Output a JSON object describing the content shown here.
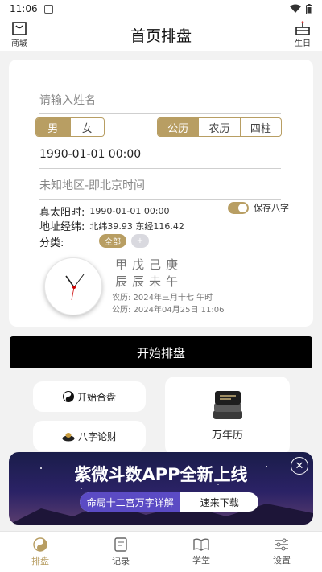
{
  "status_bar": {
    "time": "11:06"
  },
  "header": {
    "title": "首页排盘",
    "left_label": "商城",
    "right_label": "生日"
  },
  "form": {
    "name_placeholder": "请输入姓名",
    "gender": [
      "男",
      "女"
    ],
    "gender_selected": "男",
    "calendar": [
      "公历",
      "农历",
      "四柱"
    ],
    "calendar_selected": "公历",
    "birth_datetime": "1990-01-01 00:00",
    "location": "未知地区-即北京时间"
  },
  "info": {
    "solar_label": "真太阳时:",
    "solar_value": "1990-01-01 00:00",
    "coord_label": "地址经纬:",
    "coord_value": "北纬39.93 东经116.42",
    "category_label": "分类:",
    "chip_all": "全部",
    "chip_add": "+",
    "save_label": "保存八字",
    "save_enabled": true
  },
  "bazi": {
    "stems": [
      "甲",
      "戊",
      "己",
      "庚"
    ],
    "branches": [
      "辰",
      "辰",
      "未",
      "午"
    ],
    "lunar_line": "农历: 2024年三月十七 午时",
    "solar_line": "公历: 2024年04月25日 11:06"
  },
  "actions": {
    "start_button": "开始排盘",
    "match_label": "开始合盘",
    "wealth_label": "八字论财",
    "calendar_label": "万年历"
  },
  "banner": {
    "headline": "紫微斗数APP全新上线",
    "pill_left": "命局十二宫万字详解",
    "pill_right": "速来下载",
    "close_glyph": "✕"
  },
  "tabs": [
    {
      "label": "排盘",
      "icon": "taiji-icon",
      "active": true
    },
    {
      "label": "记录",
      "icon": "notes-icon",
      "active": false
    },
    {
      "label": "学堂",
      "icon": "book-icon",
      "active": false
    },
    {
      "label": "设置",
      "icon": "sliders-icon",
      "active": false
    }
  ],
  "colors": {
    "accent": "#b89e63",
    "banner_accent": "#5b4bc4"
  }
}
